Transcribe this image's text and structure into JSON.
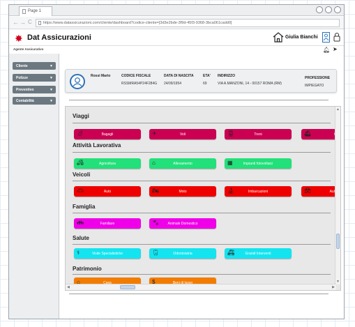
{
  "browser": {
    "tab_title": "Page 1",
    "url": "https://www.datassicurazioni.com/cliente/dashboard?codice-cliente=[3d3e2bde-3f9d-45f3-9368-3bca061cadd0]",
    "nav_back": "←",
    "nav_forward": "→",
    "nav_reload": "C"
  },
  "app": {
    "logo_glyph": "✸",
    "title": "Dat Assicurazioni",
    "user_name": "Giulia Bianchi",
    "agent_label": "Agente Assicurativo"
  },
  "sidebar": {
    "items": [
      {
        "label": "Cliente"
      },
      {
        "label": "Polizze"
      },
      {
        "label": "Preventivo"
      },
      {
        "label": "Contabilità"
      }
    ]
  },
  "profile": {
    "name": "Rossi Mario",
    "fiscal_code_header": "CODICE FISCALE",
    "fiscal_code": "RSSMRA54P24F284G",
    "birth_date_header": "DATA DI NASCITA",
    "birth_date": "24/09/1954",
    "age_header": "ETA'",
    "age": "69",
    "address_header": "INDIRIZZO",
    "address": "VIA A.MANZONI, 14 - 00157 ROMA (RM)",
    "profession_header": "PROFESSIONE",
    "profession": "IMPIEGATO"
  },
  "sections": {
    "viaggi": {
      "title": "Viaggi",
      "buttons": [
        "Bagagli",
        "Voli",
        "Treni",
        "Cr"
      ]
    },
    "lavoro": {
      "title": "Attività Lavorativa",
      "buttons": [
        "Agricoltura",
        "Allevamento",
        "Impianti fotovoltaici"
      ]
    },
    "veicoli": {
      "title": "Veicoli",
      "buttons": [
        "Auto",
        "Moto",
        "Imbarcazioni",
        "Auto d'"
      ]
    },
    "famiglia": {
      "title": "Famiglia",
      "buttons": [
        "Familiare",
        "Animale Domestico"
      ]
    },
    "salute": {
      "title": "Salute",
      "buttons": [
        "Visite Specialistiche",
        "Odontoiatria",
        "Grandi Interventi"
      ]
    },
    "patrimonio": {
      "title": "Patrimonio",
      "buttons": [
        "Casa",
        "Beni di lusso"
      ]
    }
  },
  "colors": {
    "viaggi": "#cc0052",
    "lavoro": "#22e07a",
    "veicoli": "#ef0000",
    "famiglia": "#f000e8",
    "salute": "#14e4f0",
    "patrimonio": "#f27c00",
    "accent": "#2d71b8"
  }
}
